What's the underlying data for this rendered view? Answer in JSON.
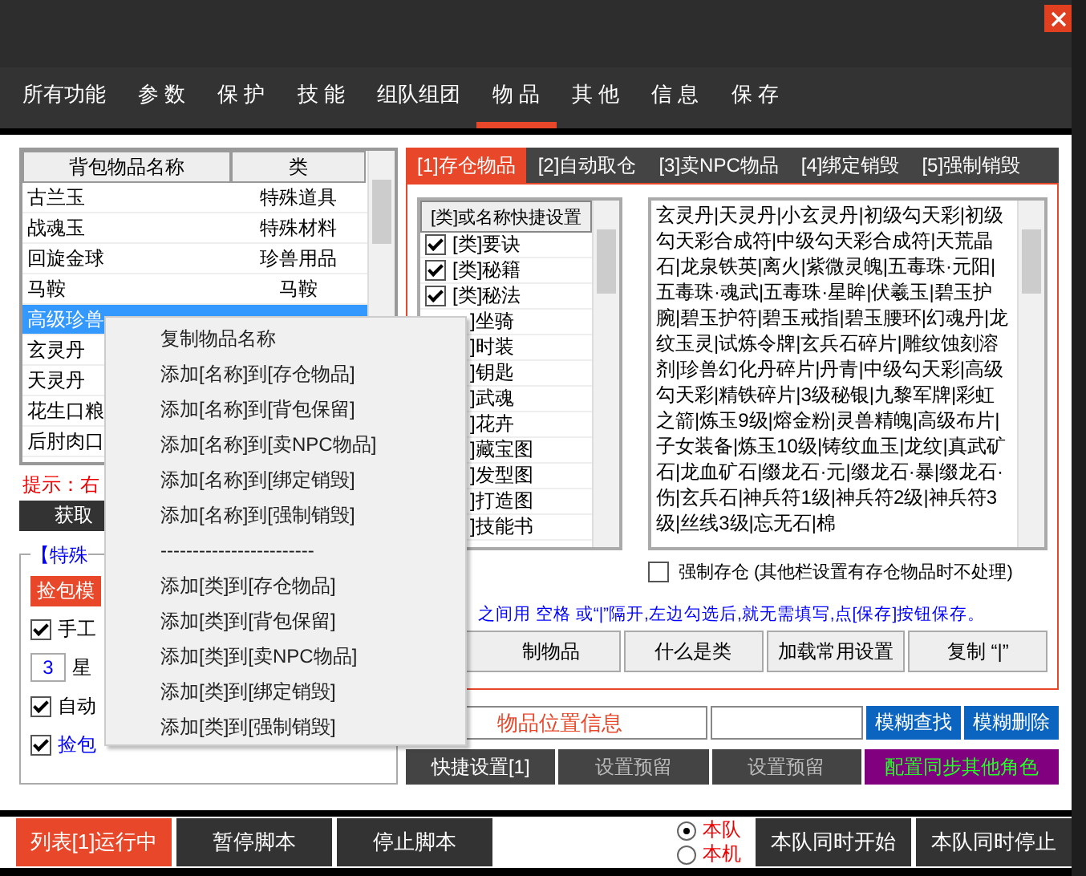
{
  "nav_tabs": [
    {
      "label": "所有功能",
      "selected": false
    },
    {
      "label": "参 数",
      "selected": false
    },
    {
      "label": "保 护",
      "selected": false
    },
    {
      "label": "技 能",
      "selected": false
    },
    {
      "label": "组队组团",
      "selected": false
    },
    {
      "label": "物 品",
      "selected": true
    },
    {
      "label": "其 他",
      "selected": false
    },
    {
      "label": "信 息",
      "selected": false
    },
    {
      "label": "保 存",
      "selected": false
    }
  ],
  "bag_table": {
    "columns": [
      "背包物品名称",
      "类"
    ],
    "rows": [
      {
        "name": "古兰玉",
        "category": "特殊道具",
        "selected": false
      },
      {
        "name": "战魂玉",
        "category": "特殊材料",
        "selected": false
      },
      {
        "name": "回旋金球",
        "category": "珍兽用品",
        "selected": false
      },
      {
        "name": "马鞍",
        "category": "马鞍",
        "selected": false
      },
      {
        "name": "高级珍兽",
        "selected": true
      },
      {
        "name": "玄灵丹",
        "selected": false
      },
      {
        "name": "天灵丹",
        "selected": false
      },
      {
        "name": "花生口粮",
        "selected": false
      },
      {
        "name": "后肘肉口",
        "selected": false
      }
    ]
  },
  "hint": "提示：右",
  "fetch_button": "获取",
  "special_group": {
    "title": "【特殊",
    "mode_label": "捡包模",
    "manual": {
      "label": "手工",
      "checked": true
    },
    "star_value": "3",
    "star_label": "星",
    "auto": {
      "label": "自动",
      "checked": true
    },
    "after_pick": {
      "label": "捡包",
      "checked": true
    }
  },
  "item_tabs": [
    {
      "label": "[1]存仓物品",
      "selected": true
    },
    {
      "label": "[2]自动取仓",
      "selected": false
    },
    {
      "label": "[3]卖NPC物品",
      "selected": false
    },
    {
      "label": "[4]绑定销毁",
      "selected": false
    },
    {
      "label": "[5]强制销毁",
      "selected": false
    }
  ],
  "category_header": "[类]或名称快捷设置",
  "categories": [
    {
      "label": "[类]要诀",
      "checked": true
    },
    {
      "label": "[类]秘籍",
      "checked": true
    },
    {
      "label": "[类]秘法",
      "checked": true
    },
    {
      "label": "]坐骑"
    },
    {
      "label": "]时装"
    },
    {
      "label": "]钥匙"
    },
    {
      "label": "]武魂"
    },
    {
      "label": "]花卉"
    },
    {
      "label": "]藏宝图"
    },
    {
      "label": "]发型图"
    },
    {
      "label": "]打造图"
    },
    {
      "label": "]技能书"
    }
  ],
  "item_list_text": "玄灵丹|天灵丹|小玄灵丹|初级勾天彩|初级勾天彩合成符|中级勾天彩合成符|天荒晶石|龙泉铁英|离火|紫微灵魄|五毒珠·元阳|五毒珠·魂武|五毒珠·星眸|伏羲玉|碧玉护腕|碧玉护符|碧玉戒指|碧玉腰环|幻魂丹|龙纹玉灵|试炼令牌|玄兵石碎片|雕纹蚀刻溶剂|珍兽幻化丹碎片|丹青|中级勾天彩|高级勾天彩|精铁碎片|3级秘银|九黎军牌|彩虹之箭|炼玉9级|熔金粉|灵兽精魄|高级布片|子女装备|炼玉10级|铸纹血玉|龙纹|真武矿石|龙血矿石|缀龙石·元|缀龙石·暴|缀龙石·伤|玄兵石|神兵符1级|神兵符2级|神兵符3级|丝线3级|忘无石|棉",
  "force_store": {
    "label": "强制存仓 (其他栏设置有存仓物品时不处理)",
    "checked": false
  },
  "blue_hint": "之间用  空格  或“|”隔开,左边勾选后,就无需填写,点[保存]按钮保存。",
  "panel_buttons": [
    "制物品",
    "什么是类",
    "加载常用设置",
    "复制 “|”"
  ],
  "location_label": "物品位置信息",
  "search_buttons": [
    "模糊查找",
    "模糊删除"
  ],
  "preset_buttons": [
    {
      "label": "快捷设置[1]",
      "kind": "normal"
    },
    {
      "label": "设置预留",
      "kind": "disabled"
    },
    {
      "label": "设置预留",
      "kind": "disabled"
    },
    {
      "label": "配置同步其他角色",
      "kind": "sync"
    }
  ],
  "context_menu": [
    "复制物品名称",
    "添加[名称]到[存仓物品]",
    "添加[名称]到[背包保留]",
    "添加[名称]到[卖NPC物品]",
    "添加[名称]到[绑定销毁]",
    "添加[名称]到[强制销毁]",
    "------------------------",
    "添加[类]到[存仓物品]",
    "添加[类]到[背包保留]",
    "添加[类]到[卖NPC物品]",
    "添加[类]到[绑定销毁]",
    "添加[类]到[强制销毁]"
  ],
  "bottom": {
    "run_button": {
      "label": "列表[1]运行中",
      "on": true
    },
    "pause": "暂停脚本",
    "stop": "停止脚本",
    "scope": [
      {
        "label": "本队",
        "selected": true
      },
      {
        "label": "本机",
        "selected": false
      }
    ],
    "team_start": "本队同时开始",
    "team_stop": "本队同时停止"
  }
}
